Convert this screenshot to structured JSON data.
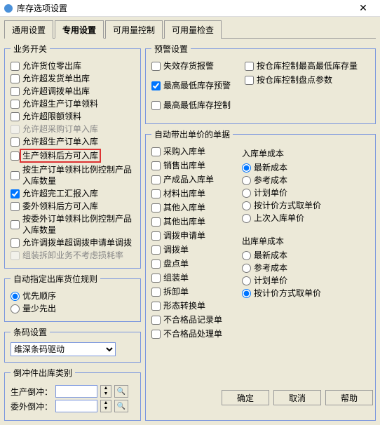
{
  "window": {
    "title": "库存选项设置"
  },
  "tabs": [
    "通用设置",
    "专用设置",
    "可用量控制",
    "可用量检查"
  ],
  "active_tab": 1,
  "groups": {
    "biz_switch": "业务开关",
    "auto_slot": "自动指定出库货位规则",
    "barcode": "条码设置",
    "offset": "倒冲件出库类别",
    "warning": "预警设置",
    "auto_price": "自动带出单价的单据"
  },
  "biz": [
    "允许货位零出库",
    "允许超发货单出库",
    "允许超调拨单出库",
    "允许超生产订单领料",
    "允许超限额领料",
    "允许超采购订单入库",
    "允许超生产订单入库",
    "生产领料后方可入库",
    "按生产订单领料比例控制产品入库数量",
    "允许超完工汇报入库",
    "委外领料后方可入库",
    "按委外订单领料比例控制产品入库数量",
    "允许调拨单超调拨申请单调拨",
    "组装拆卸业务不考虑损耗率"
  ],
  "biz_state": {
    "5": "disabled",
    "7": "highlight",
    "9": "checked",
    "13": "disabled"
  },
  "slot_opts": [
    "优先顺序",
    "量少先出"
  ],
  "slot_sel": 0,
  "barcode_opt": "维深条码驱动",
  "offset_rows": [
    "生产倒冲：",
    "委外倒冲："
  ],
  "warn_left": [
    "失效存货报警",
    "最高最低库存预警",
    "最高最低库存控制"
  ],
  "warn_left_checked": [
    1
  ],
  "warn_right": [
    "按仓库控制最高最低库存量",
    "按仓库控制盘点参数"
  ],
  "docs": [
    "采购入库单",
    "销售出库单",
    "产成品入库单",
    "材料出库单",
    "其他入库单",
    "其他出库单",
    "调拨申请单",
    "调拨单",
    "盘点单",
    "组装单",
    "拆卸单",
    "形态转换单",
    "不合格品记录单",
    "不合格品处理单"
  ],
  "in_cost_head": "入库单成本",
  "in_cost": [
    "最新成本",
    "参考成本",
    "计划单价",
    "按计价方式取单价",
    "上次入库单价"
  ],
  "in_cost_sel": 0,
  "out_cost_head": "出库单成本",
  "out_cost": [
    "最新成本",
    "参考成本",
    "计划单价",
    "按计价方式取单价"
  ],
  "out_cost_sel": 3,
  "buttons": {
    "ok": "确定",
    "cancel": "取消",
    "help": "帮助"
  }
}
